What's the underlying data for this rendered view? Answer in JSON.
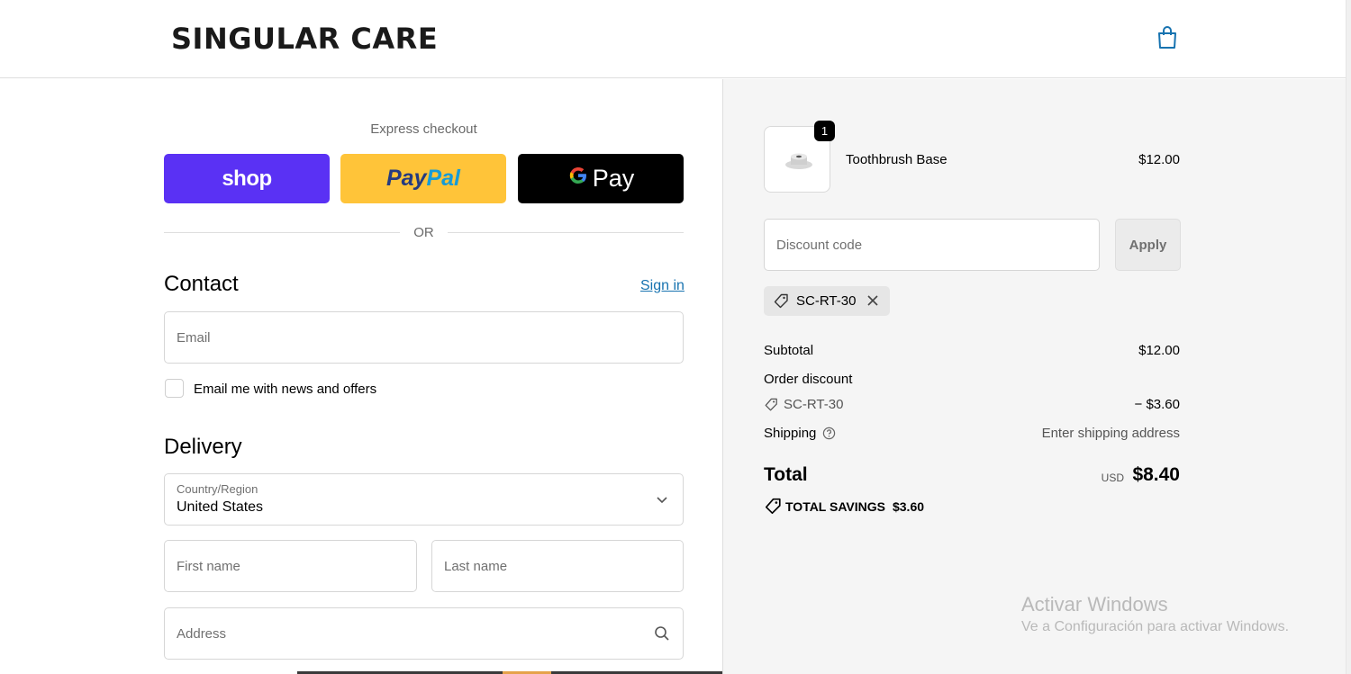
{
  "header": {
    "brand": "SINGULAR CARE",
    "cart_icon": "shopping-bag-icon"
  },
  "express": {
    "title": "Express checkout",
    "shop_label": "shop",
    "paypal_label_1": "Pay",
    "paypal_label_2": "Pal",
    "gpay_g": "G",
    "gpay_label": "Pay",
    "or_label": "OR"
  },
  "contact": {
    "title": "Contact",
    "signin_label": "Sign in",
    "email_placeholder": "Email",
    "newsletter_label": "Email me with news and offers"
  },
  "delivery": {
    "title": "Delivery",
    "country_label": "Country/Region",
    "country_value": "United States",
    "first_name_placeholder": "First name",
    "last_name_placeholder": "Last name",
    "address_placeholder": "Address"
  },
  "summary": {
    "product_name": "Toothbrush Base",
    "product_price": "$12.00",
    "quantity": "1",
    "discount_placeholder": "Discount code",
    "apply_label": "Apply",
    "applied_code": "SC-RT-30",
    "subtotal_label": "Subtotal",
    "subtotal_value": "$12.00",
    "order_discount_label": "Order discount",
    "discount_code": "SC-RT-30",
    "discount_value": "− $3.60",
    "shipping_label": "Shipping",
    "shipping_value": "Enter shipping address",
    "total_label": "Total",
    "total_currency": "USD",
    "total_value": "$8.40",
    "savings_label": "TOTAL SAVINGS",
    "savings_value": "$3.60"
  },
  "watermark": {
    "title": "Activar Windows",
    "subtitle": "Ve a Configuración para activar Windows."
  },
  "colors": {
    "shop": "#5a31f4",
    "paypal": "#ffc439",
    "link": "#1773b0",
    "summary_bg": "#f5f5f5"
  }
}
